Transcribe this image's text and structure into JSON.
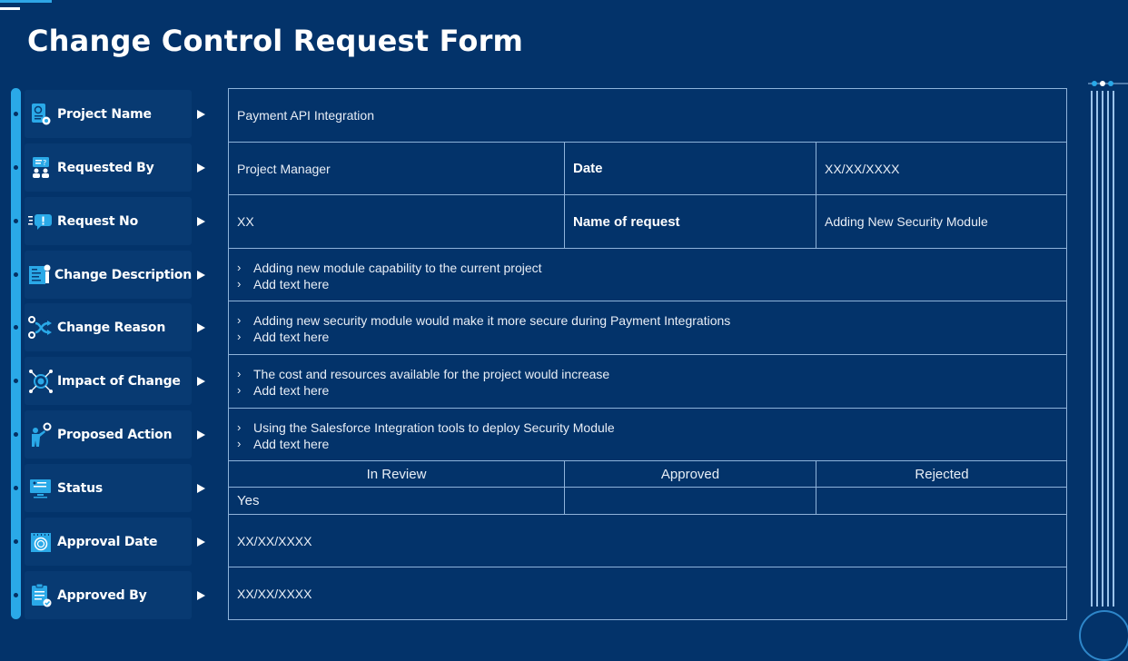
{
  "title": "Change Control Request Form",
  "colors": {
    "background": "#03336a",
    "accent": "#2aa9e8",
    "border": "#8fb3da"
  },
  "sidebar": {
    "items": [
      {
        "label": "Project Name",
        "icon": "project-document-gear-icon"
      },
      {
        "label": "Requested By",
        "icon": "people-question-icon"
      },
      {
        "label": "Request No",
        "icon": "speech-bubble-exclamation-icon"
      },
      {
        "label": "Change Description",
        "icon": "document-pen-icon"
      },
      {
        "label": "Change Reason",
        "icon": "shuffle-gears-icon"
      },
      {
        "label": "Impact of Change",
        "icon": "impact-network-icon"
      },
      {
        "label": "Proposed Action",
        "icon": "person-gear-icon"
      },
      {
        "label": "Status",
        "icon": "monitor-icon"
      },
      {
        "label": "Approval Date",
        "icon": "calendar-icon"
      },
      {
        "label": "Approved By",
        "icon": "clipboard-check-icon"
      }
    ]
  },
  "form": {
    "project_name": "Payment API Integration",
    "requested_by": "Project Manager",
    "date_label": "Date",
    "date_value": "XX/XX/XXXX",
    "request_no": "XX",
    "name_of_request_label": "Name of request",
    "name_of_request_value": "Adding  New Security Module",
    "bullet_glyph": "›",
    "change_description": [
      "Adding  new  module capability to the current project",
      "Add text here"
    ],
    "change_reason": [
      "Adding  new security module would  make it more secure during  Payment Integrations",
      "Add text here"
    ],
    "impact_of_change": [
      "The cost and resources available for the project would increase",
      "Add text here"
    ],
    "proposed_action": [
      "Using the Salesforce Integration  tools to deploy Security Module",
      "Add text here"
    ],
    "status": {
      "headers": [
        "In Review",
        "Approved",
        "Rejected"
      ],
      "values": [
        "Yes",
        "",
        ""
      ]
    },
    "approval_date": "XX/XX/XXXX",
    "approved_by": "XX/XX/XXXX"
  }
}
